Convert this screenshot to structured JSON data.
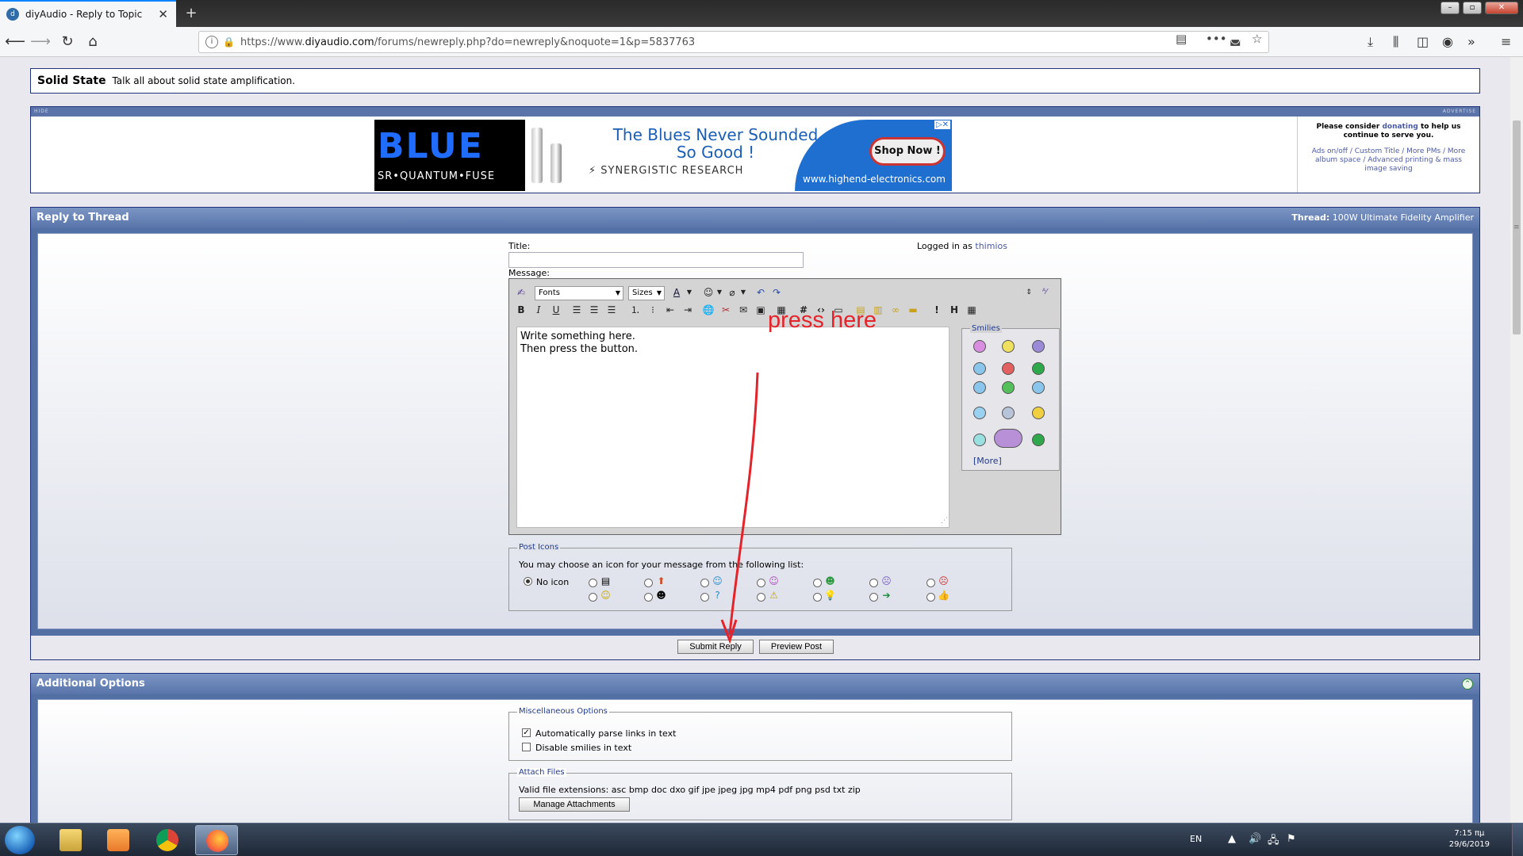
{
  "browser": {
    "tab_title": "diyAudio - Reply to Topic",
    "tab_close": "✕",
    "new_tab": "+",
    "url_prefix": "https://www.",
    "url_domain": "diyaudio.com",
    "url_path": "/forums/newreply.php?do=newreply&noquote=1&p=5837763"
  },
  "forum": {
    "name": "Solid State",
    "description": "Talk all about solid state amplification."
  },
  "ad": {
    "strip_left": "HIDE",
    "strip_right": "ADVERTISE",
    "banner_brand": "BLUE",
    "banner_sub": "SR•QUANTUM•FUSE",
    "banner_tagline_1": "The Blues Never Sounded",
    "banner_tagline_2": "So Good !",
    "banner_logo": "SYNERGISTIC RESEARCH",
    "banner_logo_red": "RESEARCH",
    "banner_shop": "Shop Now !",
    "banner_site": "www.highend-electronics.com",
    "side_text_1": "Please consider",
    "side_link_1": "donating",
    "side_text_2": "to help us continue to serve you.",
    "side_links": "Ads on/off / Custom Title / More PMs / More album space / Advanced printing & mass image saving"
  },
  "reply": {
    "header": "Reply to Thread",
    "thread_label": "Thread:",
    "thread_name": "100W Ultimate Fidelity Amplifier",
    "title_label": "Title:",
    "logged_in_label": "Logged in as",
    "username": "thimios",
    "message_label": "Message:",
    "font_select": "Fonts",
    "size_select": "Sizes",
    "message_text_line1": "Write something here.",
    "message_text_line2": "Then press the button.",
    "smilies_legend": "Smilies",
    "smilies_more": "[More]",
    "post_icons_legend": "Post Icons",
    "post_icons_desc": "You may choose an icon for your message from the following list:",
    "no_icon_label": "No icon",
    "submit_label": "Submit Reply",
    "preview_label": "Preview Post"
  },
  "annotation": {
    "text": "press here",
    "color": "#e4232a"
  },
  "additional": {
    "header": "Additional Options",
    "misc_legend": "Miscellaneous Options",
    "parse_links_label": "Automatically parse links in text",
    "parse_links_checked": true,
    "disable_smilies_label": "Disable smilies in text",
    "disable_smilies_checked": false,
    "attach_legend": "Attach Files",
    "valid_ext_label": "Valid file extensions: asc bmp doc dxo gif jpe jpeg jpg mp4 pdf png psd txt zip",
    "manage_attachments_label": "Manage Attachments"
  },
  "taskbar": {
    "language": "EN",
    "time": "7:15 πμ",
    "date": "29/6/2019"
  },
  "colors": {
    "header_blue": "#5874aa",
    "border_navy": "#20337a",
    "link": "#4b5aa3"
  }
}
